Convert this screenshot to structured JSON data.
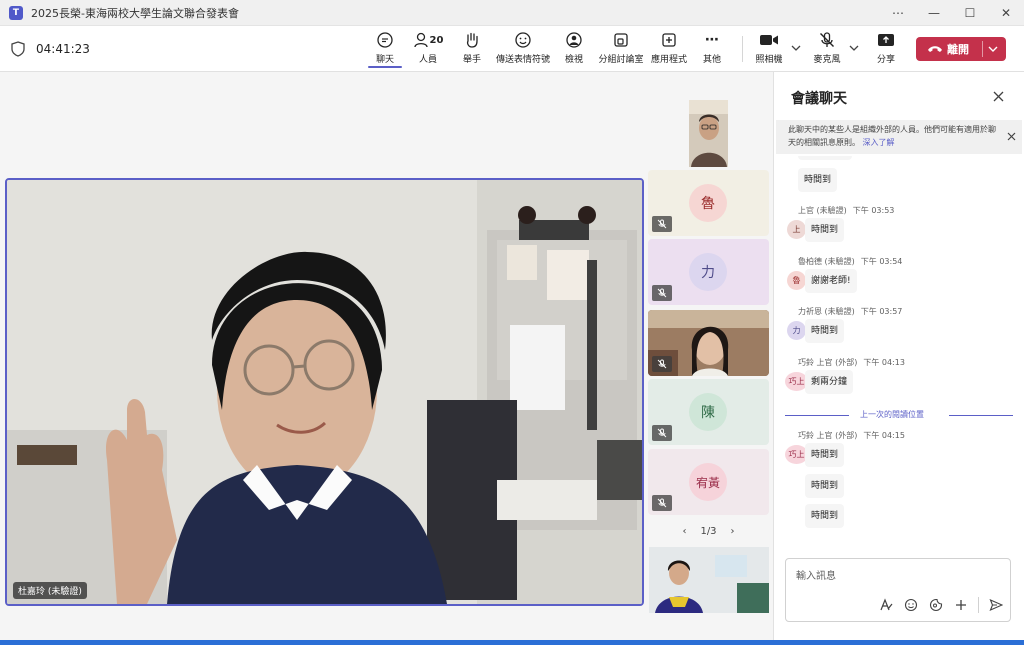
{
  "window": {
    "title": "2025長榮-東海兩校大學生論文聯合發表會"
  },
  "toolbar": {
    "timer": "04:41:23",
    "chat": "聊天",
    "people": "人員",
    "people_count": "20",
    "raise_hand": "舉手",
    "react": "傳送表情符號",
    "view": "檢視",
    "rooms": "分組討論室",
    "apps": "應用程式",
    "more": "其他",
    "camera": "照相機",
    "mic": "麥克風",
    "share": "分享",
    "leave": "離開"
  },
  "stage": {
    "main_speaker": "杜嘉玲 (未驗證)",
    "tiles": [
      {
        "initial": "魯"
      },
      {
        "initial": "力"
      },
      {
        "initial": "陳"
      },
      {
        "initial": "宥黃"
      }
    ],
    "pager": "1/3"
  },
  "chat": {
    "title": "會議聊天",
    "notice_text": "此聊天中的某些人是組織外部的人員。他們可能有適用於聊天的相關訊息原則。",
    "notice_link": "深入了解",
    "messages": [
      {
        "text": "時間到"
      },
      {
        "sender": "上官 (未驗證)",
        "time": "下午 03:53",
        "avatar": "上",
        "text": "時間到"
      },
      {
        "sender": "魯柏德 (未驗證)",
        "time": "下午 03:54",
        "avatar": "魯",
        "text": "謝謝老師!"
      },
      {
        "sender": "力祈恩 (未驗證)",
        "time": "下午 03:57",
        "avatar": "力",
        "text": "時間到"
      },
      {
        "sender": "巧鈴 上官 (外部)",
        "time": "下午 04:13",
        "avatar": "巧上",
        "text": "剩兩分鐘"
      },
      {
        "sender": "巧鈴 上官 (外部)",
        "time": "下午 04:15",
        "avatar": "巧上",
        "text": "時間到"
      },
      {
        "text": "時間到"
      },
      {
        "text": "時間到"
      }
    ],
    "last_read": "上一次的閱讀位置",
    "compose_placeholder": "輸入訊息"
  },
  "colors": {
    "accent": "#5b5fc7",
    "leave": "#c4314b"
  }
}
